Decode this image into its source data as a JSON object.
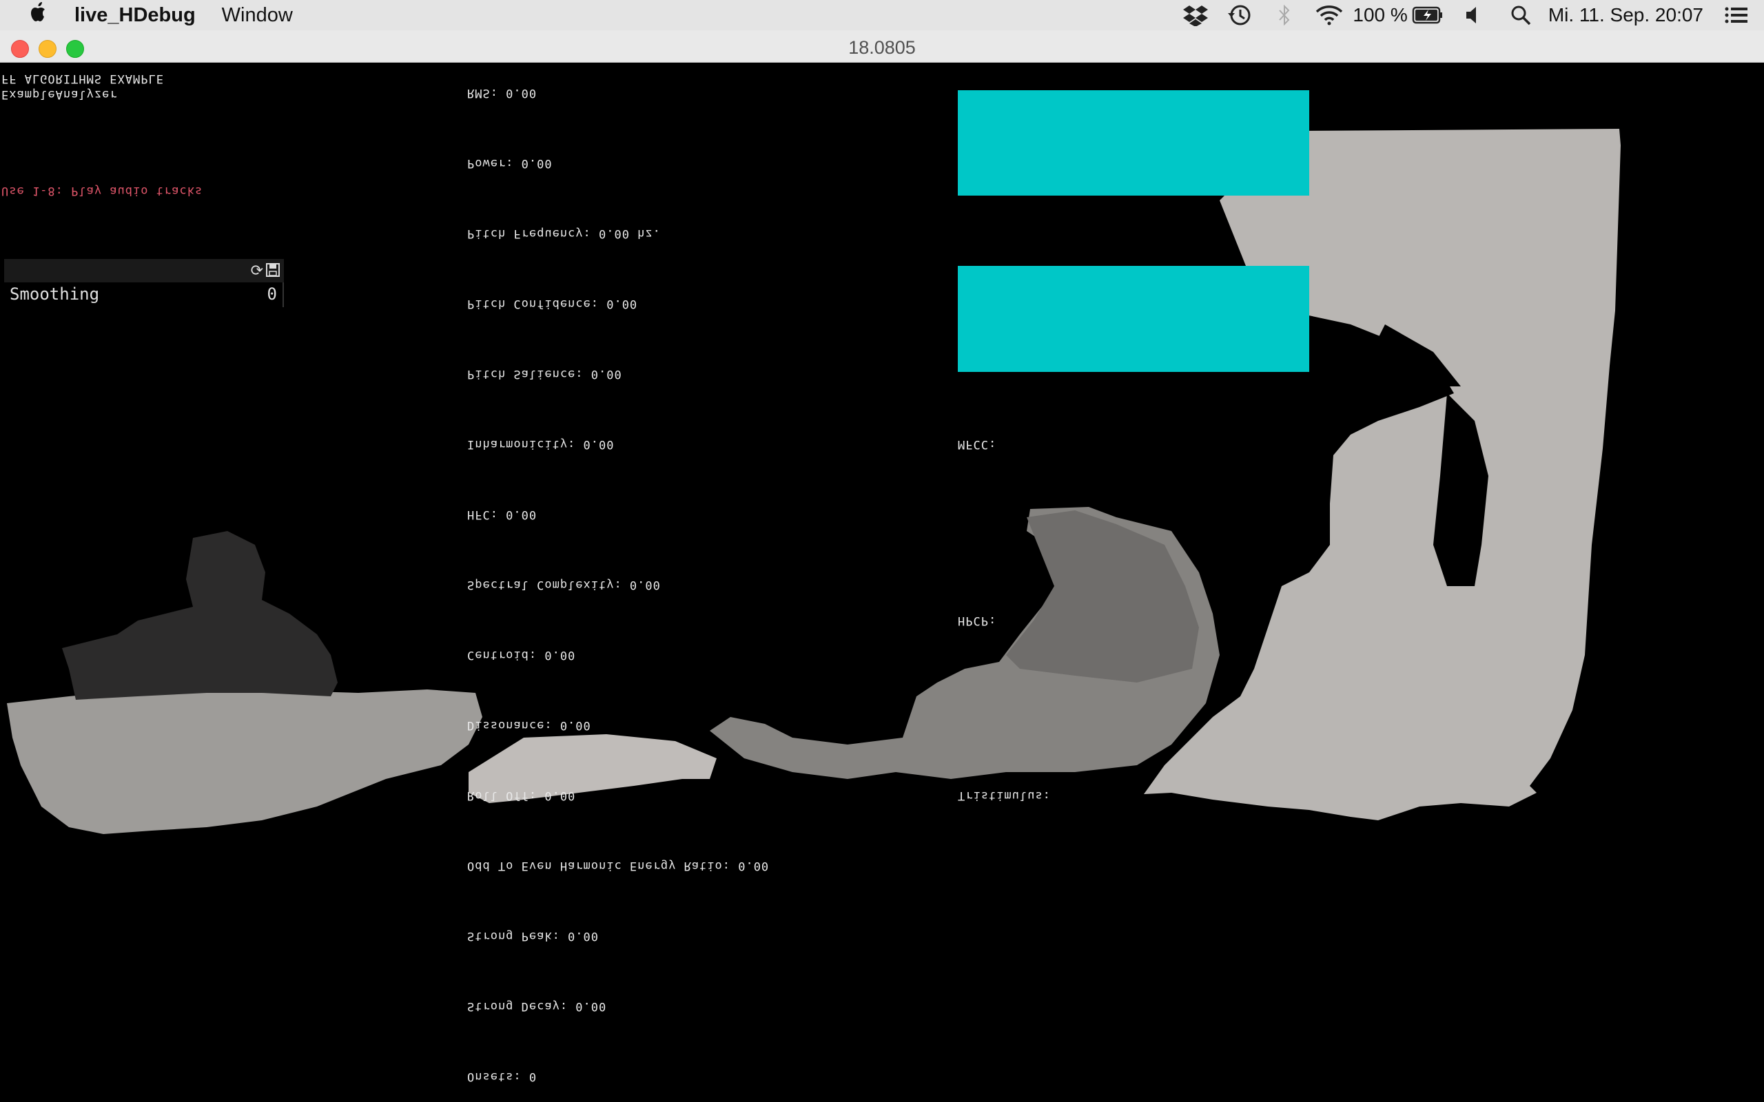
{
  "menubar": {
    "app_name": "live_HDebug",
    "menus": [
      "Window"
    ],
    "status": {
      "battery_percent": "100 %",
      "datetime": "Mi. 11. Sep.  20:07"
    },
    "icons": [
      "apple-icon",
      "dropbox-icon",
      "time-machine-icon",
      "bluetooth-icon",
      "wifi-icon",
      "battery-icon",
      "volume-icon",
      "spotlight-icon",
      "notification-center-icon"
    ]
  },
  "window": {
    "title": "18.0805"
  },
  "left_panel": {
    "header_line_1": "FF ALGORITHMS EXAMPLE",
    "header_line_2": "ExampleAnalyzer",
    "hint": "Use 1-8: Play audio tracks",
    "gui": {
      "row_label": "Smoothing",
      "row_value": "0"
    }
  },
  "feature_labels": [
    "RMS: 0.00",
    "Power: 0.00",
    "Pitch Frequency: 0.00 hz.",
    "Pitch Confidence: 0.00",
    "Pitch Salience: 0.00",
    "Inharmonicity: 0.00",
    "HFC: 0.00",
    "Spectral Complexity: 0.00",
    "Centroid: 0.00",
    "Dissonance: 0.00",
    "Roll Off: 0.00",
    "Odd To Even Harmonic Energy Ratio: 0.00",
    "Strong Peak: 0.00",
    "Strong Decay: 0.00",
    "Onsets: 0"
  ],
  "right_labels": {
    "mfcc": "MFCC:",
    "hpcp": "HPCP:",
    "tristimulus": "Tristimulus:"
  },
  "colors": {
    "accent_cyan": "#00c7c7",
    "hint_red": "#e0566a",
    "background": "#000000"
  }
}
